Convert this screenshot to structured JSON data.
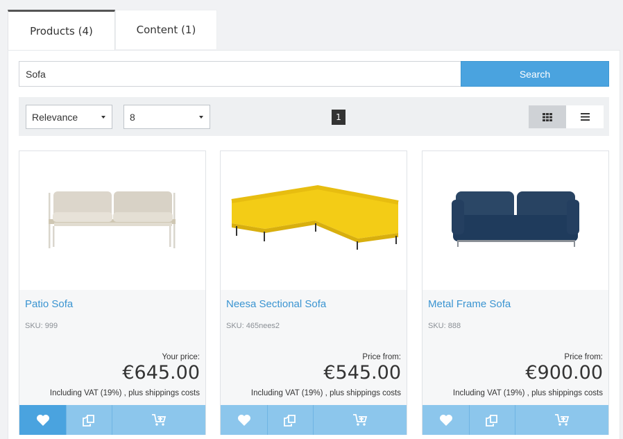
{
  "tabs": [
    {
      "label": "Products (4)",
      "active": true
    },
    {
      "label": "Content (1)",
      "active": false
    }
  ],
  "search": {
    "value": "Sofa",
    "button_label": "Search"
  },
  "toolbar": {
    "sort": {
      "selected": "Relevance"
    },
    "per_page": {
      "selected": "8"
    },
    "page": "1",
    "view_modes": [
      "grid-view-icon",
      "list-view-icon"
    ]
  },
  "products": [
    {
      "title": "Patio Sofa",
      "sku": "SKU: 999",
      "price_label": "Your price:",
      "price": "€645.00",
      "vat_text": "Including VAT (19%) ,",
      "shipping_link": "plus shippings costs"
    },
    {
      "title": "Neesa Sectional Sofa",
      "sku": "SKU: 465nees2",
      "price_label": "Price from:",
      "price": "€545.00",
      "vat_text": "Including VAT (19%) ,",
      "shipping_link": "plus shippings costs"
    },
    {
      "title": "Metal Frame Sofa",
      "sku": "SKU: 888",
      "price_label": "Price from:",
      "price": "€900.00",
      "vat_text": "Including VAT (19%) ,",
      "shipping_link": "plus shippings costs"
    }
  ],
  "card_action_icons": [
    "heart-icon",
    "compare-icon",
    "add-to-cart-icon"
  ],
  "colors": {
    "accent": "#4aa3df",
    "accent_light": "#8cc6ec",
    "link": "#3a94d1",
    "page_background": "#f1f2f4"
  }
}
